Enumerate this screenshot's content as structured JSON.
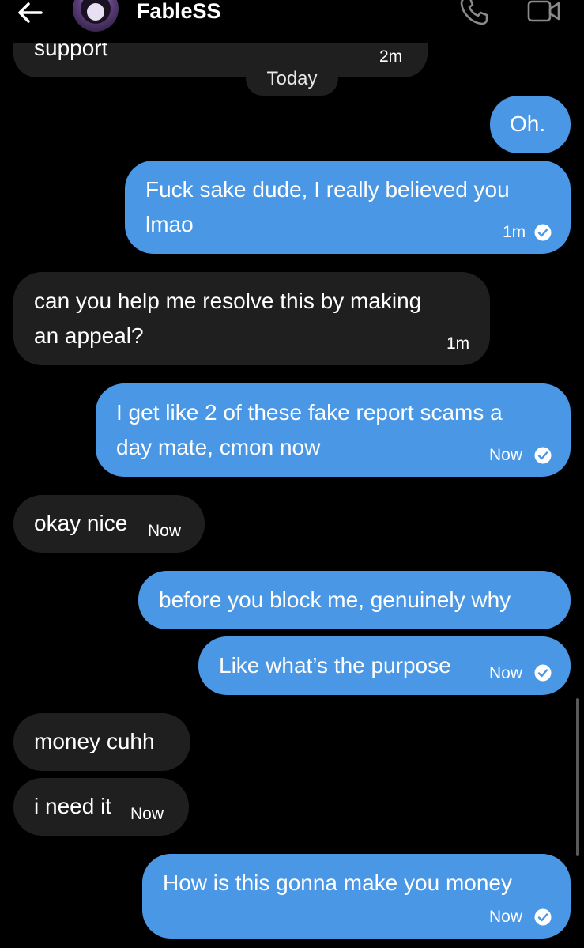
{
  "header": {
    "contact_name": "FableSS",
    "back_icon": "arrow-left-icon",
    "call_icon": "phone-icon",
    "video_icon": "video-camera-icon"
  },
  "date_divider": "Today",
  "colors": {
    "incoming_bubble": "#1f1f1f",
    "outgoing_bubble": "#4a97e6",
    "background": "#000000"
  },
  "messages": [
    {
      "direction": "in",
      "text": "support",
      "time": "2m"
    },
    {
      "direction": "out",
      "text": "Oh.",
      "time": ""
    },
    {
      "direction": "out",
      "text_lines": [
        "Fuck sake dude, I really believed you",
        "lmao"
      ],
      "time": "1m",
      "seen": true
    },
    {
      "direction": "in",
      "text_lines": [
        "can you help me resolve this by making",
        "an appeal?"
      ],
      "time": "1m"
    },
    {
      "direction": "out",
      "text_lines": [
        "I get like 2 of these fake report scams a",
        "day mate, cmon now"
      ],
      "time": "Now",
      "seen": true
    },
    {
      "direction": "in",
      "text": "okay nice",
      "time": "Now"
    },
    {
      "direction": "out",
      "text": "before you block me, genuinely why",
      "time": ""
    },
    {
      "direction": "out",
      "text": "Like what’s the purpose",
      "time": "Now",
      "seen": true
    },
    {
      "direction": "in",
      "text": "money cuhh",
      "time": ""
    },
    {
      "direction": "in",
      "text": "i need it",
      "time": "Now"
    },
    {
      "direction": "out",
      "text": "How is this gonna make you money",
      "time": "Now",
      "seen": true
    }
  ]
}
